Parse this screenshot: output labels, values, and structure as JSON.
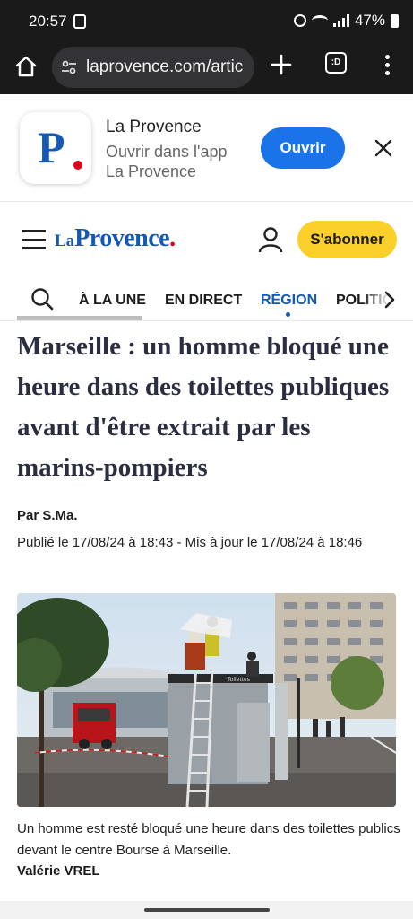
{
  "status_bar": {
    "time": "20:57",
    "battery": "47%"
  },
  "browser": {
    "url": "laprovence.com/artic",
    "tabs_icon_label": ":D"
  },
  "app_banner": {
    "name": "La Provence",
    "subtitle": "Ouvrir dans l'app La Provence",
    "open_label": "Ouvrir"
  },
  "site_header": {
    "logo_la": "La",
    "logo_provence": "Provence",
    "logo_dot": ".",
    "subscribe_label": "S'abonner"
  },
  "nav": {
    "tabs": [
      {
        "label": "À LA UNE"
      },
      {
        "label": "EN DIRECT"
      },
      {
        "label": "RÉGION"
      },
      {
        "label": "POLITIQUE"
      }
    ],
    "active_tab": "RÉGION"
  },
  "article": {
    "headline": "Marseille : un homme bloqué une heure dans des toilettes publiques avant d'être extrait par les marins-pompiers",
    "byline_prefix": "Par",
    "author": "S.Ma.",
    "dates": "Publié le 17/08/24 à 18:43 - Mis à jour le 17/08/24 à 18:46",
    "photo_sign": "Toilettes",
    "caption": "Un homme est resté bloqué une heure dans des toilettes publics devant le centre Bourse à Marseille.",
    "credit": "Valérie VREL"
  },
  "colors": {
    "brand_blue": "#1459b5",
    "brand_red": "#e1001a",
    "subscribe_yellow": "#fcd02b",
    "open_button_blue": "#1a73e8"
  }
}
